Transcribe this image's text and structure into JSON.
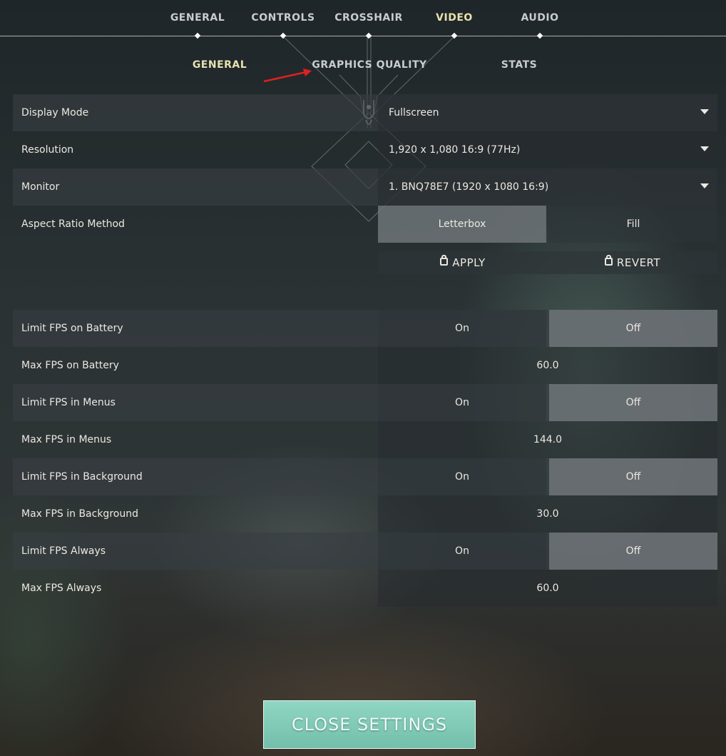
{
  "top_tabs": [
    {
      "label": "GENERAL",
      "active": false
    },
    {
      "label": "CONTROLS",
      "active": false
    },
    {
      "label": "CROSSHAIR",
      "active": false
    },
    {
      "label": "VIDEO",
      "active": true
    },
    {
      "label": "AUDIO",
      "active": false
    }
  ],
  "sub_tabs": [
    {
      "label": "GENERAL",
      "active": true
    },
    {
      "label": "GRAPHICS QUALITY",
      "active": false
    },
    {
      "label": "STATS",
      "active": false
    }
  ],
  "display": {
    "display_mode": {
      "label": "Display Mode",
      "value": "Fullscreen"
    },
    "resolution": {
      "label": "Resolution",
      "value": "1,920 x 1,080 16:9 (77Hz)"
    },
    "monitor": {
      "label": "Monitor",
      "value": "1. BNQ78E7 (1920 x  1080 16:9)"
    },
    "aspect_ratio": {
      "label": "Aspect Ratio Method",
      "options": [
        "Letterbox",
        "Fill"
      ],
      "selected": "Letterbox"
    },
    "apply_label": "APPLY",
    "revert_label": "REVERT"
  },
  "fps": {
    "limit_battery": {
      "label": "Limit FPS on Battery",
      "on": "On",
      "off": "Off",
      "selected": "Off"
    },
    "max_battery": {
      "label": "Max FPS on Battery",
      "value": "60.0"
    },
    "limit_menus": {
      "label": "Limit FPS in Menus",
      "on": "On",
      "off": "Off",
      "selected": "Off"
    },
    "max_menus": {
      "label": "Max FPS in Menus",
      "value": "144.0"
    },
    "limit_background": {
      "label": "Limit FPS in Background",
      "on": "On",
      "off": "Off",
      "selected": "Off"
    },
    "max_background": {
      "label": "Max FPS in Background",
      "value": "30.0"
    },
    "limit_always": {
      "label": "Limit FPS Always",
      "on": "On",
      "off": "Off",
      "selected": "Off"
    },
    "max_always": {
      "label": "Max FPS Always",
      "value": "60.0"
    }
  },
  "close_label": "CLOSE SETTINGS",
  "colors": {
    "active_tab": "#e8e2b0",
    "close_button": "#7fcbb6",
    "annotation_arrow": "#e02020"
  }
}
